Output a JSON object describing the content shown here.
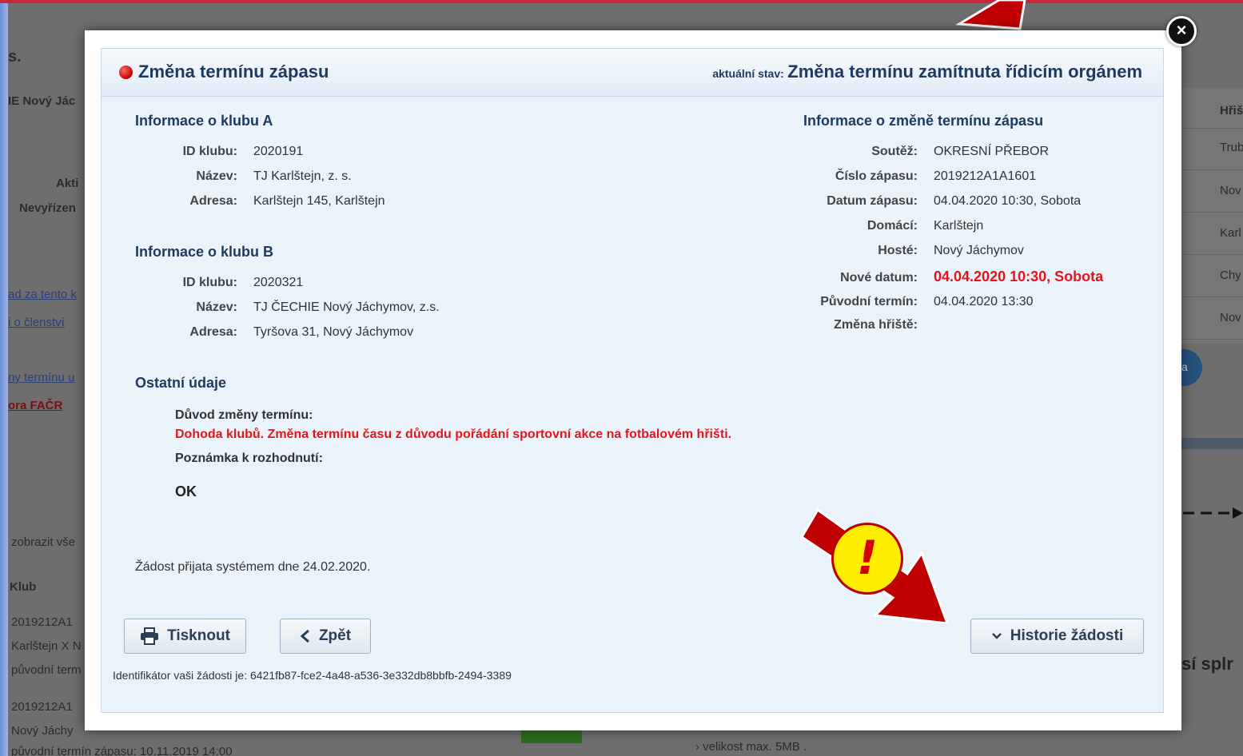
{
  "background": {
    "title_fragment": "s.",
    "club_fragment": "IE Nový Jác",
    "akti_fragment": "Akti",
    "nevyrizen_fragment": "Nevyřízen",
    "link1": "ad za tento k",
    "link2": "i o členství",
    "link3": "ny termínu u",
    "link4": "ora FAČR",
    "zobrazit": "zobrazit vše",
    "klub_header": "Klub",
    "row1_code": "2019212A1",
    "row1_teams": "Karlštejn X N",
    "row1_original": "původní term",
    "row2_code": "2019212A1",
    "row2_teams": "Nový Jáchy",
    "row2_original": "původní termín zápasu: 10.11.2019 14:00",
    "right_header": "Hřiš",
    "right_rows": [
      "Trub",
      "Nov",
      "Karl",
      "Chy",
      "Nov"
    ],
    "pill_text": "a",
    "plni_text": "sí splr",
    "size_text": "› velikost max. 5MB ."
  },
  "modal": {
    "close_symbol": "×",
    "title": "Změna termínu zápasu",
    "state_label": "aktuální stav:",
    "state_value": "Změna termínu zamítnuta řídicím orgánem",
    "club_a": {
      "heading": "Informace o klubu A",
      "id_label": "ID klubu:",
      "id_value": "2020191",
      "name_label": "Název:",
      "name_value": "TJ Karlštejn, z. s.",
      "address_label": "Adresa:",
      "address_value": "Karlštejn 145, Karlštejn"
    },
    "club_b": {
      "heading": "Informace o klubu B",
      "id_label": "ID klubu:",
      "id_value": "2020321",
      "name_label": "Název:",
      "name_value": "TJ ČECHIE Nový Jáchymov, z.s.",
      "address_label": "Adresa:",
      "address_value": "Tyršova 31, Nový Jáchymov"
    },
    "change": {
      "heading": "Informace o změně termínu zápasu",
      "competition_label": "Soutěž:",
      "competition_value": "OKRESNÍ PŘEBOR",
      "match_no_label": "Číslo zápasu:",
      "match_no_value": "2019212A1A1601",
      "date_label": "Datum zápasu:",
      "date_value": "04.04.2020 10:30, Sobota",
      "home_label": "Domácí:",
      "home_value": "Karlštejn",
      "guests_label": "Hosté:",
      "guests_value": "Nový Jáchymov",
      "new_date_label": "Nové datum:",
      "new_date_value": "04.04.2020 10:30, Sobota",
      "original_label": "Původní termín:",
      "original_value": "04.04.2020 13:30",
      "field_change_label": "Změna hřiště:"
    },
    "other": {
      "heading": "Ostatní údaje",
      "reason_label": "Důvod změny termínu:",
      "reason_value": "Dohoda klubů. Změna termínu času z důvodu pořádání sportovní akce na fotbalovém hřišti.",
      "note_label": "Poznámka k rozhodnutí:",
      "note_value": "OK"
    },
    "received_text": "Žádost přijata systémem dne 24.02.2020.",
    "buttons": {
      "print": "Tisknout",
      "back": "Zpět",
      "history": "Historie žádosti"
    },
    "request_id_text": "Identifikátor vaši žádosti je: 6421fb87-fce2-4a48-a536-3e332db8bbfb-2494-3389"
  },
  "annotation": {
    "warning_symbol": "!",
    "colors": {
      "arrow": "#c00000",
      "warning_fill": "#ffee00"
    }
  }
}
